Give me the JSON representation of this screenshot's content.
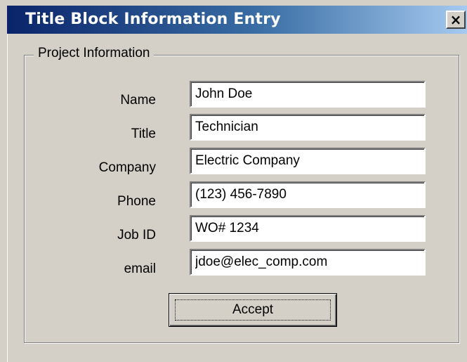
{
  "window": {
    "title": "Title Block Information Entry",
    "close_symbol": "×"
  },
  "group": {
    "legend": "Project Information"
  },
  "fields": [
    {
      "label": "Name",
      "value": "John Doe"
    },
    {
      "label": "Title",
      "value": "Technician"
    },
    {
      "label": "Company",
      "value": "Electric Company"
    },
    {
      "label": "Phone",
      "value": "(123) 456-7890"
    },
    {
      "label": "Job ID",
      "value": "WO# 1234"
    },
    {
      "label": "email",
      "value": "jdoe@elec_comp.com"
    }
  ],
  "buttons": {
    "accept_label": "Accept"
  },
  "colors": {
    "titlebar_start": "#0a246a",
    "titlebar_end": "#a6caf0",
    "dialog_face": "#d4d0c8"
  }
}
